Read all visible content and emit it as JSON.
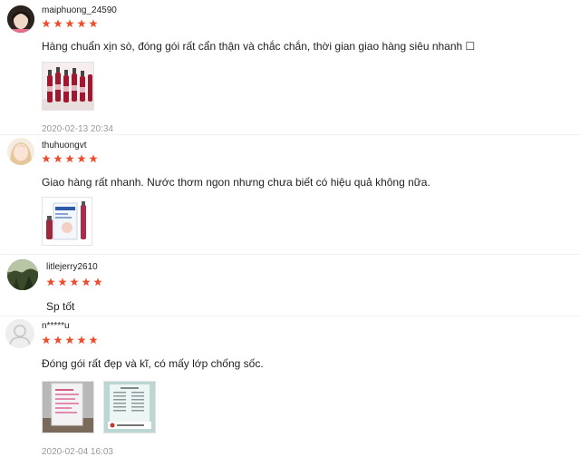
{
  "reviews": [
    {
      "username": "maiphuong_24590",
      "rating": 5,
      "comment": "Hàng chuẩn xịn sò, đóng gói rất cẩn thận và chắc chắn, thời gian giao hàng siêu nhanh ☐",
      "timestamp": "2020-02-13 20:34"
    },
    {
      "username": "thuhuongvt",
      "rating": 5,
      "comment": "Giao hàng rất nhanh. Nước thơm ngon nhưng chưa biết có hiệu quả không nữa."
    },
    {
      "username": "litlejerry2610",
      "rating": 5,
      "comment": "Sp tốt"
    },
    {
      "username": "n*****u",
      "rating": 5,
      "comment": "Đóng gói rất đẹp và kĩ, có mấy lớp chống sốc.",
      "timestamp": "2020-02-04 16:03"
    }
  ],
  "colors": {
    "star": "#ee4d2d",
    "timestamp": "#999999"
  },
  "icons": {
    "star": "star-icon",
    "default_avatar": "user-silhouette-icon"
  }
}
